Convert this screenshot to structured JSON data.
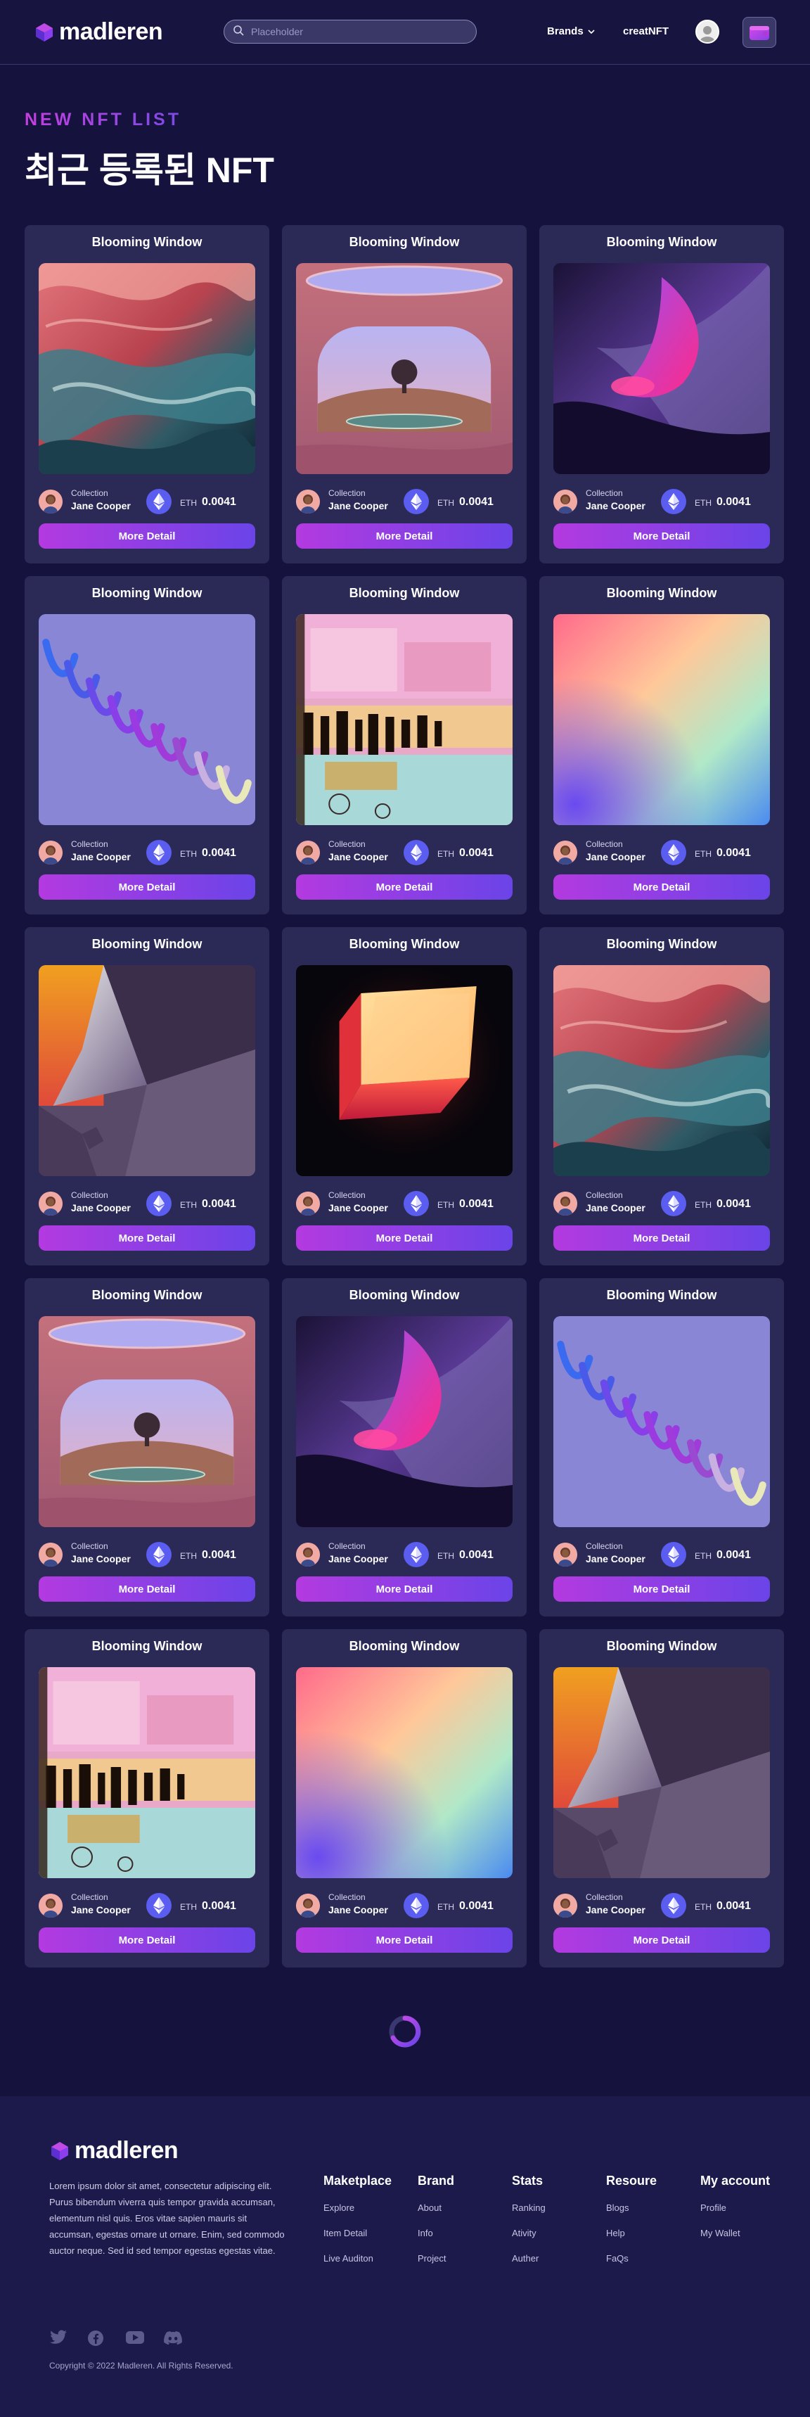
{
  "header": {
    "brand": "madleren",
    "search_placeholder": "Placeholder",
    "nav_brands": "Brands",
    "nav_create": "creatNFT"
  },
  "hero": {
    "kicker": "NEW NFT LIST",
    "title": "최근 등록된 NFT"
  },
  "cards": [
    {
      "title": "Blooming Window",
      "art": "fluid-red-teal",
      "collection_label": "Collection",
      "creator": "Jane Cooper",
      "currency": "ETH",
      "price": "0.0041",
      "button": "More Detail"
    },
    {
      "title": "Blooming Window",
      "art": "arch-tree",
      "collection_label": "Collection",
      "creator": "Jane Cooper",
      "currency": "ETH",
      "price": "0.0041",
      "button": "More Detail"
    },
    {
      "title": "Blooming Window",
      "art": "purple-swoosh",
      "collection_label": "Collection",
      "creator": "Jane Cooper",
      "currency": "ETH",
      "price": "0.0041",
      "button": "More Detail"
    },
    {
      "title": "Blooming Window",
      "art": "spiral-ribbon",
      "collection_label": "Collection",
      "creator": "Jane Cooper",
      "currency": "ETH",
      "price": "0.0041",
      "button": "More Detail"
    },
    {
      "title": "Blooming Window",
      "art": "abstract-paint",
      "collection_label": "Collection",
      "creator": "Jane Cooper",
      "currency": "ETH",
      "price": "0.0041",
      "button": "More Detail"
    },
    {
      "title": "Blooming Window",
      "art": "pastel-gradient",
      "collection_label": "Collection",
      "creator": "Jane Cooper",
      "currency": "ETH",
      "price": "0.0041",
      "button": "More Detail"
    },
    {
      "title": "Blooming Window",
      "art": "geometric-3d",
      "collection_label": "Collection",
      "creator": "Jane Cooper",
      "currency": "ETH",
      "price": "0.0041",
      "button": "More Detail"
    },
    {
      "title": "Blooming Window",
      "art": "glowing-cube",
      "collection_label": "Collection",
      "creator": "Jane Cooper",
      "currency": "ETH",
      "price": "0.0041",
      "button": "More Detail"
    },
    {
      "title": "Blooming Window",
      "art": "fluid-red-teal",
      "collection_label": "Collection",
      "creator": "Jane Cooper",
      "currency": "ETH",
      "price": "0.0041",
      "button": "More Detail"
    },
    {
      "title": "Blooming Window",
      "art": "arch-tree",
      "collection_label": "Collection",
      "creator": "Jane Cooper",
      "currency": "ETH",
      "price": "0.0041",
      "button": "More Detail"
    },
    {
      "title": "Blooming Window",
      "art": "purple-swoosh",
      "collection_label": "Collection",
      "creator": "Jane Cooper",
      "currency": "ETH",
      "price": "0.0041",
      "button": "More Detail"
    },
    {
      "title": "Blooming Window",
      "art": "spiral-ribbon",
      "collection_label": "Collection",
      "creator": "Jane Cooper",
      "currency": "ETH",
      "price": "0.0041",
      "button": "More Detail"
    },
    {
      "title": "Blooming Window",
      "art": "abstract-paint",
      "collection_label": "Collection",
      "creator": "Jane Cooper",
      "currency": "ETH",
      "price": "0.0041",
      "button": "More Detail"
    },
    {
      "title": "Blooming Window",
      "art": "pastel-gradient",
      "collection_label": "Collection",
      "creator": "Jane Cooper",
      "currency": "ETH",
      "price": "0.0041",
      "button": "More Detail"
    },
    {
      "title": "Blooming Window",
      "art": "geometric-3d",
      "collection_label": "Collection",
      "creator": "Jane Cooper",
      "currency": "ETH",
      "price": "0.0041",
      "button": "More Detail"
    }
  ],
  "footer": {
    "brand": "madleren",
    "description": "Lorem ipsum dolor sit amet, consectetur adipiscing elit. Purus bibendum viverra quis tempor gravida accumsan, elementum nisl quis. Eros vitae sapien mauris sit accumsan, egestas ornare ut ornare. Enim, sed commodo auctor neque. Sed id sed tempor egestas egestas vitae.",
    "columns": [
      {
        "heading": "Maketplace",
        "links": [
          "Explore",
          "Item Detail",
          "Live Auditon"
        ]
      },
      {
        "heading": "Brand",
        "links": [
          "About",
          "Info",
          "Project"
        ]
      },
      {
        "heading": "Stats",
        "links": [
          "Ranking",
          "Ativity",
          "Auther"
        ]
      },
      {
        "heading": "Resoure",
        "links": [
          "Blogs",
          "Help",
          "FaQs"
        ]
      },
      {
        "heading": "My account",
        "links": [
          "Profile",
          "My Wallet"
        ]
      }
    ],
    "socials": [
      "twitter-icon",
      "facebook-icon",
      "youtube-icon",
      "discord-icon"
    ],
    "copyright": "Copyright © 2022 Madleren. All Rights Reserved."
  },
  "colors": {
    "background": "#15133d",
    "card": "#2b2a57",
    "accent_start": "#b33ae0",
    "accent_end": "#6a44e8",
    "eth": "#5a5df0"
  }
}
